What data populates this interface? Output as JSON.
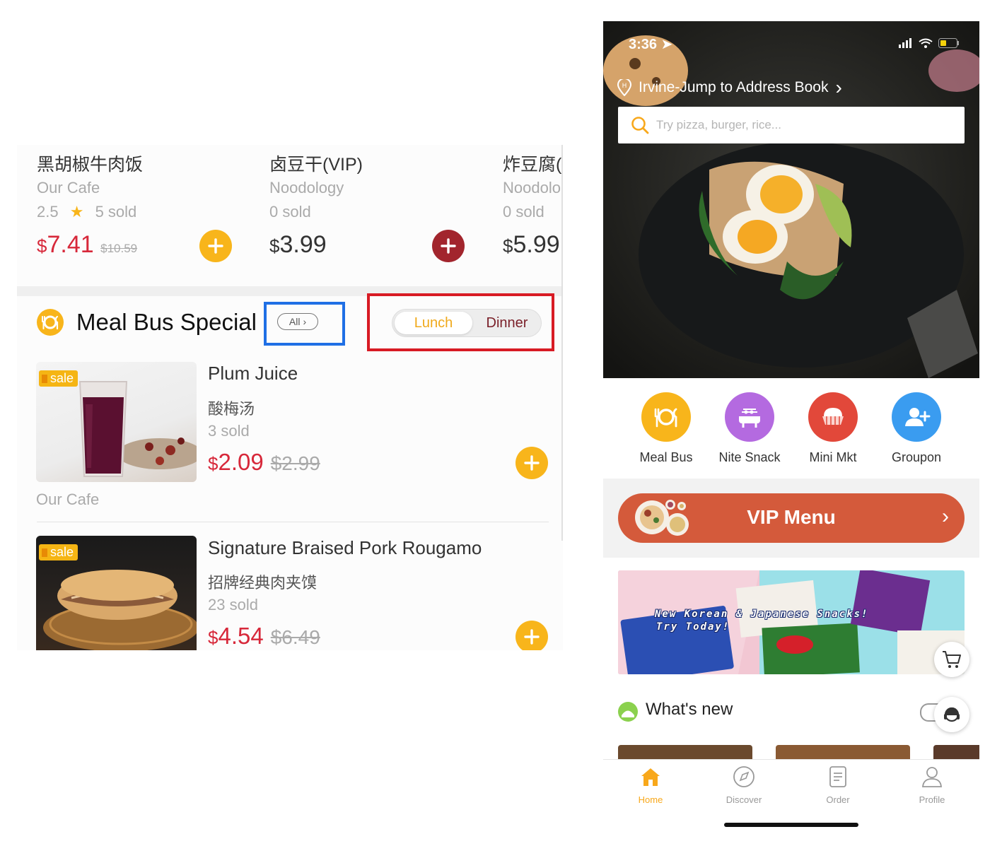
{
  "left_panel": {
    "top_items": [
      {
        "name_cn": "黑胡椒牛肉饭",
        "store": "Our Cafe",
        "rating": "2.5",
        "sold": "5 sold",
        "currency": "$",
        "price": "7.41",
        "original_price": "$10.59"
      },
      {
        "name_cn": "卤豆干(VIP)",
        "store": "Noodology",
        "sold": "0 sold",
        "currency": "$",
        "price": "3.99"
      },
      {
        "name_cn": "炸豆腐(",
        "store": "Noodolo",
        "sold": "0 sold",
        "currency": "$",
        "price": "5.99"
      }
    ],
    "section": {
      "title": "Meal Bus Special",
      "all_label": "All",
      "tabs": {
        "lunch": "Lunch",
        "dinner": "Dinner"
      }
    },
    "products": [
      {
        "badge": "sale",
        "name": "Plum Juice",
        "name_cn": "酸梅汤",
        "sold": "3 sold",
        "currency": "$",
        "price": "2.09",
        "original_price": "$2.99",
        "store": "Our Cafe"
      },
      {
        "badge": "sale",
        "name": "Signature Braised Pork Rougamo",
        "name_cn": "招牌经典肉夹馍",
        "sold": "23 sold",
        "currency": "$",
        "price": "4.54",
        "original_price": "$6.49"
      }
    ]
  },
  "phone": {
    "status_time": "3:36",
    "location": "Irvine-Jump to Address Book",
    "search_placeholder": "Try pizza, burger, rice...",
    "categories": [
      {
        "label": "Meal Bus",
        "icon": "plate-cutlery-icon",
        "color": "#f8b51b"
      },
      {
        "label": "Nite Snack",
        "icon": "bbq-grill-icon",
        "color": "#b46ae0"
      },
      {
        "label": "Mini Mkt",
        "icon": "basket-icon",
        "color": "#e2483a"
      },
      {
        "label": "Groupon",
        "icon": "add-user-icon",
        "color": "#3a9cf0"
      }
    ],
    "vip_menu": "VIP Menu",
    "banner_line1": "New Korean & Japanese Snacks!",
    "banner_line2": "Try Today!",
    "whats_new": "What's new",
    "tabs": [
      {
        "label": "Home",
        "icon": "home-icon",
        "active": true
      },
      {
        "label": "Discover",
        "icon": "compass-icon",
        "active": false
      },
      {
        "label": "Order",
        "icon": "order-list-icon",
        "active": false
      },
      {
        "label": "Profile",
        "icon": "profile-icon",
        "active": false
      }
    ]
  },
  "colors": {
    "accent_yellow": "#f8b51b",
    "price_red": "#d7283a",
    "vip_orange": "#d45a3b",
    "highlight_blue": "#1f6fe5",
    "highlight_red": "#d81b24"
  }
}
